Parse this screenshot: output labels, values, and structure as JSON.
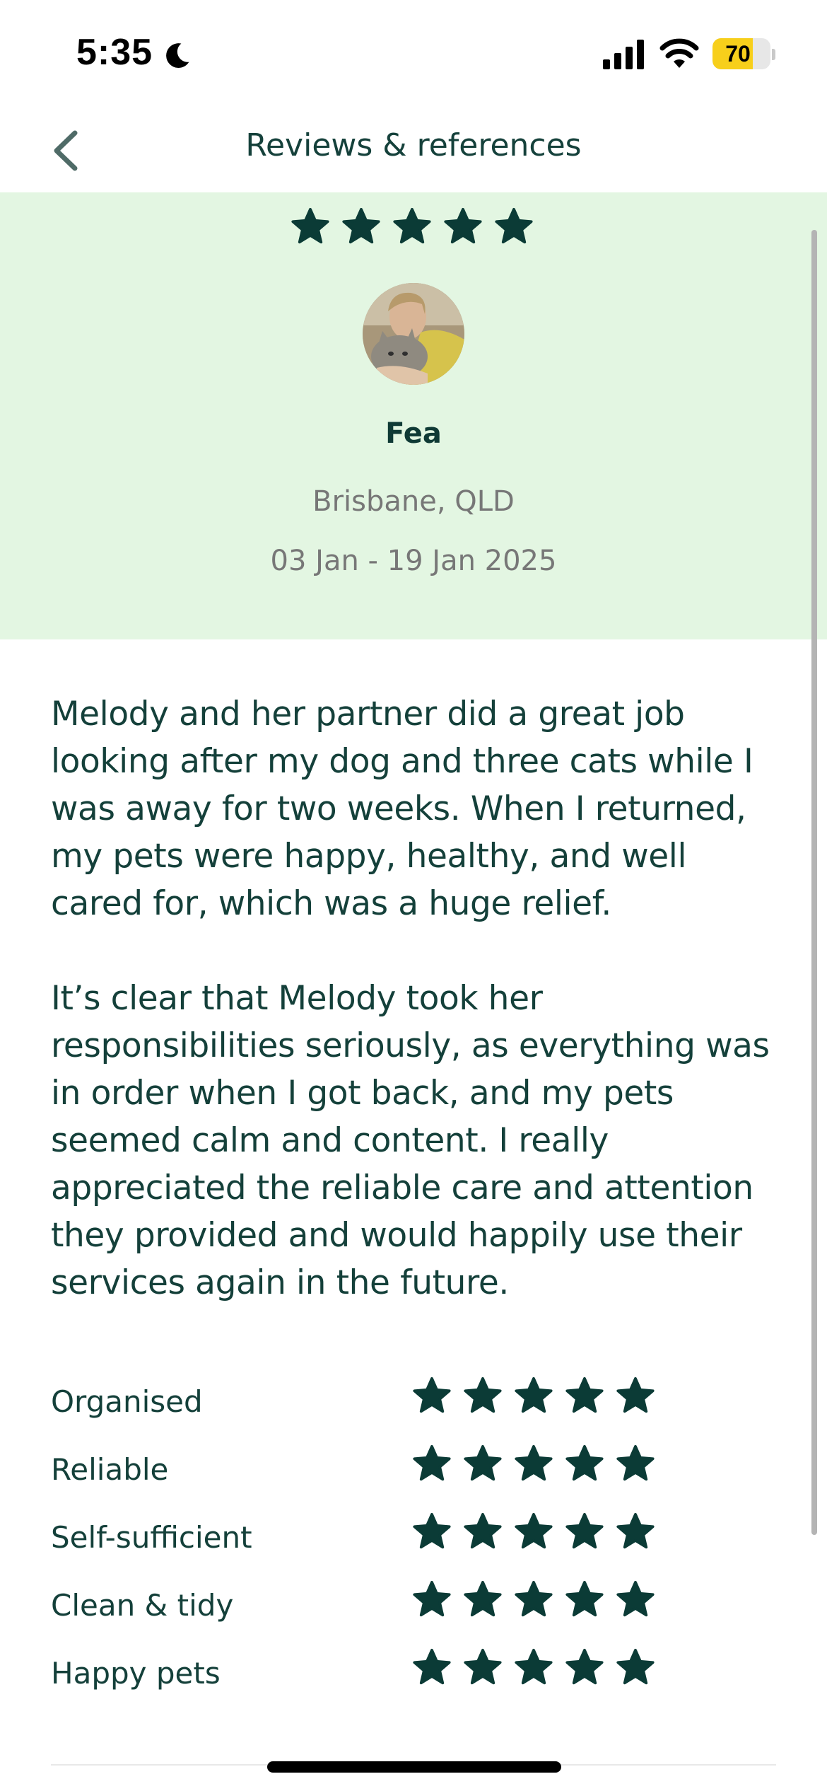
{
  "status_bar": {
    "time": "5:35",
    "battery_level": "70",
    "battery_fraction": 0.7,
    "icons": [
      "moon-icon",
      "cellular-signal-icon",
      "wifi-icon",
      "battery-icon"
    ]
  },
  "header": {
    "title": "Reviews & references",
    "back_icon": "chevron-left-icon"
  },
  "review": {
    "overall_rating": 5,
    "overall_max": 5,
    "reviewer_name": "Fea",
    "location": "Brisbane, QLD",
    "dates": "03 Jan - 19 Jan 2025",
    "paragraphs": [
      "Melody and her partner did a great job looking after my dog and three cats while I was away for two weeks. When I returned, my pets were happy, healthy, and well cared for, which was a huge relief.",
      "It’s clear that Melody took her responsibilities seriously, as everything was in order when I got back, and my pets seemed calm and content. I really appreciated the reliable care and attention they provided and would happily use their services again in the future."
    ]
  },
  "ratings": [
    {
      "label": "Organised",
      "value": 5,
      "max": 5
    },
    {
      "label": "Reliable",
      "value": 5,
      "max": 5
    },
    {
      "label": "Self-sufficient",
      "value": 5,
      "max": 5
    },
    {
      "label": "Clean & tidy",
      "value": 5,
      "max": 5
    },
    {
      "label": "Happy pets",
      "value": 5,
      "max": 5
    }
  ],
  "colors": {
    "accent_dark": "#0b3b36",
    "hero_background": "#e3f6e2",
    "battery_yellow": "#f7cf1b",
    "muted_text": "#777777"
  }
}
